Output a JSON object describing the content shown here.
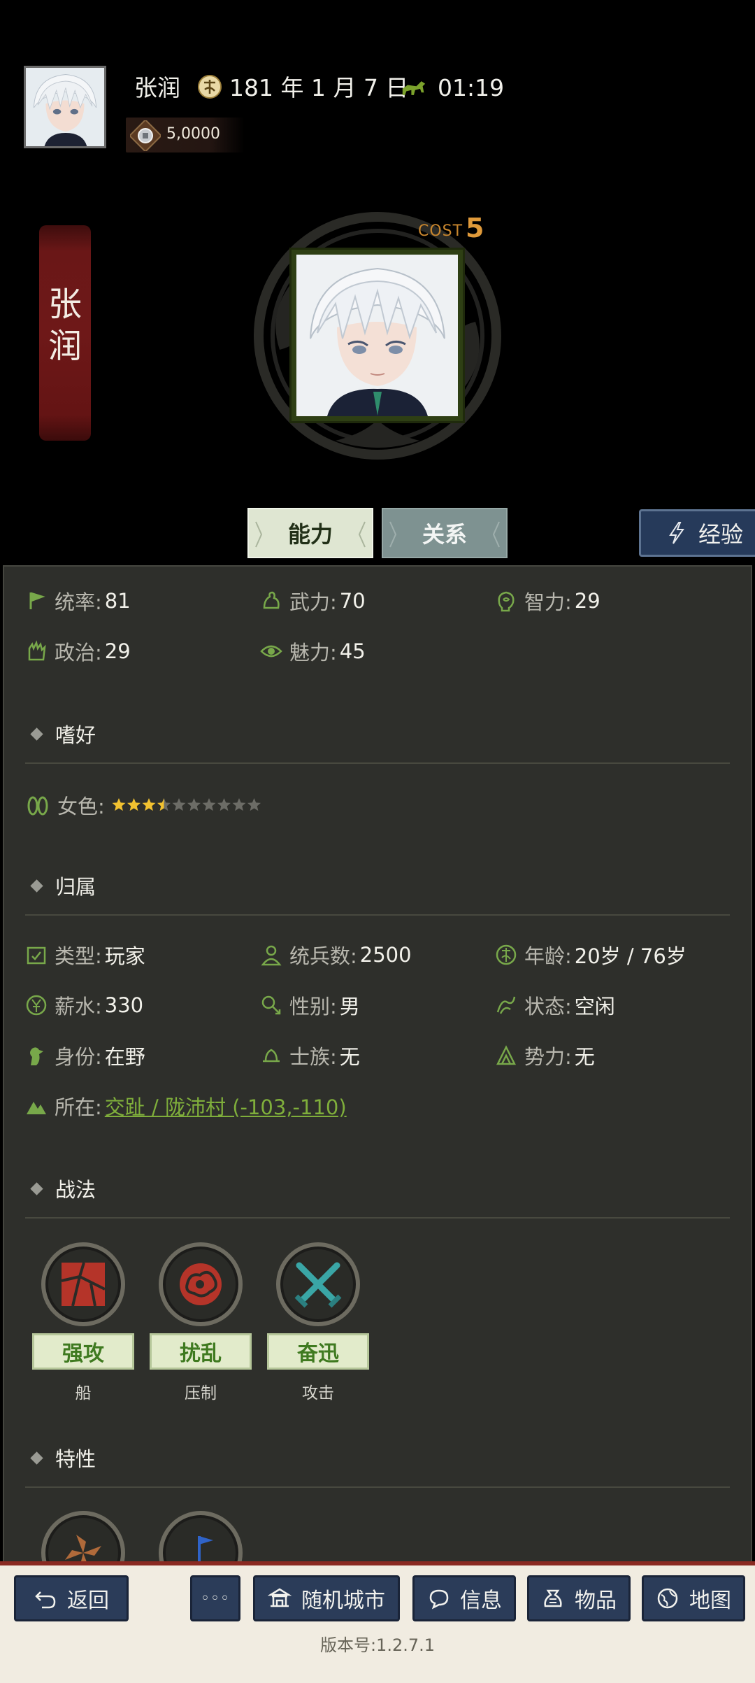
{
  "header": {
    "player_name": "张润",
    "date": "181 年 1 月 7 日",
    "time": "01:19",
    "currency": "5,0000"
  },
  "character": {
    "name": "张润",
    "name_vertical": [
      "张",
      "润"
    ],
    "cost_label": "COST",
    "cost_value": "5"
  },
  "tabs": {
    "ability": "能力",
    "relation": "关系",
    "experience": "经验"
  },
  "stats": [
    {
      "label": "统率:",
      "value": "81",
      "icon": "flag-icon"
    },
    {
      "label": "武力:",
      "value": "70",
      "icon": "arm-icon"
    },
    {
      "label": "智力:",
      "value": "29",
      "icon": "brain-icon"
    },
    {
      "label": "政治:",
      "value": "29",
      "icon": "hand-icon"
    },
    {
      "label": "魅力:",
      "value": "45",
      "icon": "eye-icon"
    }
  ],
  "hobby": {
    "title": "嗜好",
    "items": [
      {
        "label": "女色:",
        "rating": 3.5,
        "max": 10,
        "icon": "footprint-icon"
      }
    ]
  },
  "affiliation": {
    "title": "归属",
    "fields": [
      {
        "label": "类型:",
        "value": "玩家",
        "icon": "calendar-check-icon"
      },
      {
        "label": "统兵数:",
        "value": "2500",
        "icon": "person-icon"
      },
      {
        "label": "年龄:",
        "value": "20岁 / 76岁",
        "icon": "age-icon"
      },
      {
        "label": "薪水:",
        "value": "330",
        "icon": "yen-icon"
      },
      {
        "label": "性别:",
        "value": "男",
        "icon": "gender-icon"
      },
      {
        "label": "状态:",
        "value": "空闲",
        "icon": "status-icon"
      },
      {
        "label": "身份:",
        "value": "在野",
        "icon": "bird-icon"
      },
      {
        "label": "士族:",
        "value": "无",
        "icon": "clan-icon"
      },
      {
        "label": "势力:",
        "value": "无",
        "icon": "force-icon"
      }
    ],
    "location_label": "所在:",
    "location_value": "交趾 / 陇沛村 (-103,-110)"
  },
  "tactics": {
    "title": "战法",
    "items": [
      {
        "name": "强攻",
        "type": "船",
        "icon": "shatter-icon"
      },
      {
        "name": "扰乱",
        "type": "压制",
        "icon": "brain-chaos-icon"
      },
      {
        "name": "奋迅",
        "type": "攻击",
        "icon": "crossed-swords-icon"
      }
    ]
  },
  "traits": {
    "title": "特性"
  },
  "bottom_bar": {
    "back": "返回",
    "more": "◦◦◦",
    "random_city": "随机城市",
    "info": "信息",
    "items": "物品",
    "map": "地图",
    "version": "版本号:1.2.7.1"
  },
  "colors": {
    "panel_bg": "#2e2f2b",
    "accent_green": "#3f7a20",
    "link_green": "#7fae3b",
    "button_blue": "#2b3c59",
    "banner_red": "#6e1818",
    "star_gold": "#f2c230"
  }
}
